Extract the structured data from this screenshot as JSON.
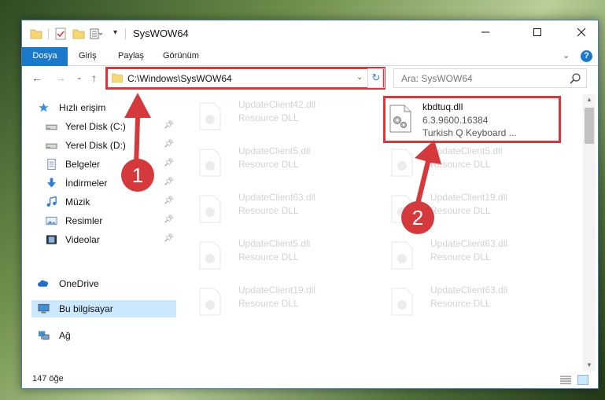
{
  "window": {
    "title": "SysWOW64"
  },
  "ribbon": {
    "tabs": [
      {
        "label": "Dosya"
      },
      {
        "label": "Giriş"
      },
      {
        "label": "Paylaş"
      },
      {
        "label": "Görünüm"
      }
    ]
  },
  "nav": {
    "address": "C:\\Windows\\SysWOW64",
    "search_placeholder": "Ara: SysWOW64"
  },
  "sidebar": {
    "items": [
      {
        "label": "Hızlı erişim",
        "icon": "star-icon",
        "pinned": false
      },
      {
        "label": "Yerel Disk (C:)",
        "icon": "drive-icon",
        "pinned": true
      },
      {
        "label": "Yerel Disk (D:)",
        "icon": "drive-icon",
        "pinned": true
      },
      {
        "label": "Belgeler",
        "icon": "documents-icon",
        "pinned": true
      },
      {
        "label": "İndirmeler",
        "icon": "download-icon",
        "pinned": true
      },
      {
        "label": "Müzik",
        "icon": "music-icon",
        "pinned": true
      },
      {
        "label": "Resimler",
        "icon": "pictures-icon",
        "pinned": true
      },
      {
        "label": "Videolar",
        "icon": "videos-icon",
        "pinned": true
      },
      {
        "label": "OneDrive",
        "icon": "cloud-icon",
        "pinned": false
      },
      {
        "label": "Bu bilgisayar",
        "icon": "computer-icon",
        "pinned": false
      },
      {
        "label": "Ağ",
        "icon": "network-icon",
        "pinned": false
      }
    ]
  },
  "files": {
    "highlighted": {
      "name": "kbdtuq.dll",
      "version": "6.3.9600.16384",
      "description": "Turkish Q Keyboard ..."
    },
    "left_column": [
      {
        "name": "UpdateClient42.dll",
        "type": "Resource DLL"
      },
      {
        "name": "UpdateClient5.dll",
        "type": "Resource DLL"
      },
      {
        "name": "UpdateClient63.dll",
        "type": "Resource DLL"
      },
      {
        "name": "UpdateClient5.dll",
        "type": "Resource DLL"
      },
      {
        "name": "UpdateClient19.dll",
        "type": "Resource DLL"
      }
    ],
    "right_column": [
      {
        "name": "UpdateClient5.dll",
        "type": "Resource DLL"
      },
      {
        "name": "UpdateClient19.dll",
        "type": "Resource DLL"
      },
      {
        "name": "UpdateClient63.dll",
        "type": "Resource DLL"
      },
      {
        "name": "UpdateClient63.dll",
        "type": "Resource DLL"
      }
    ]
  },
  "status": {
    "count": "147 öğe"
  },
  "annotations": {
    "badge1": "1",
    "badge2": "2",
    "color": "#d6393c"
  }
}
